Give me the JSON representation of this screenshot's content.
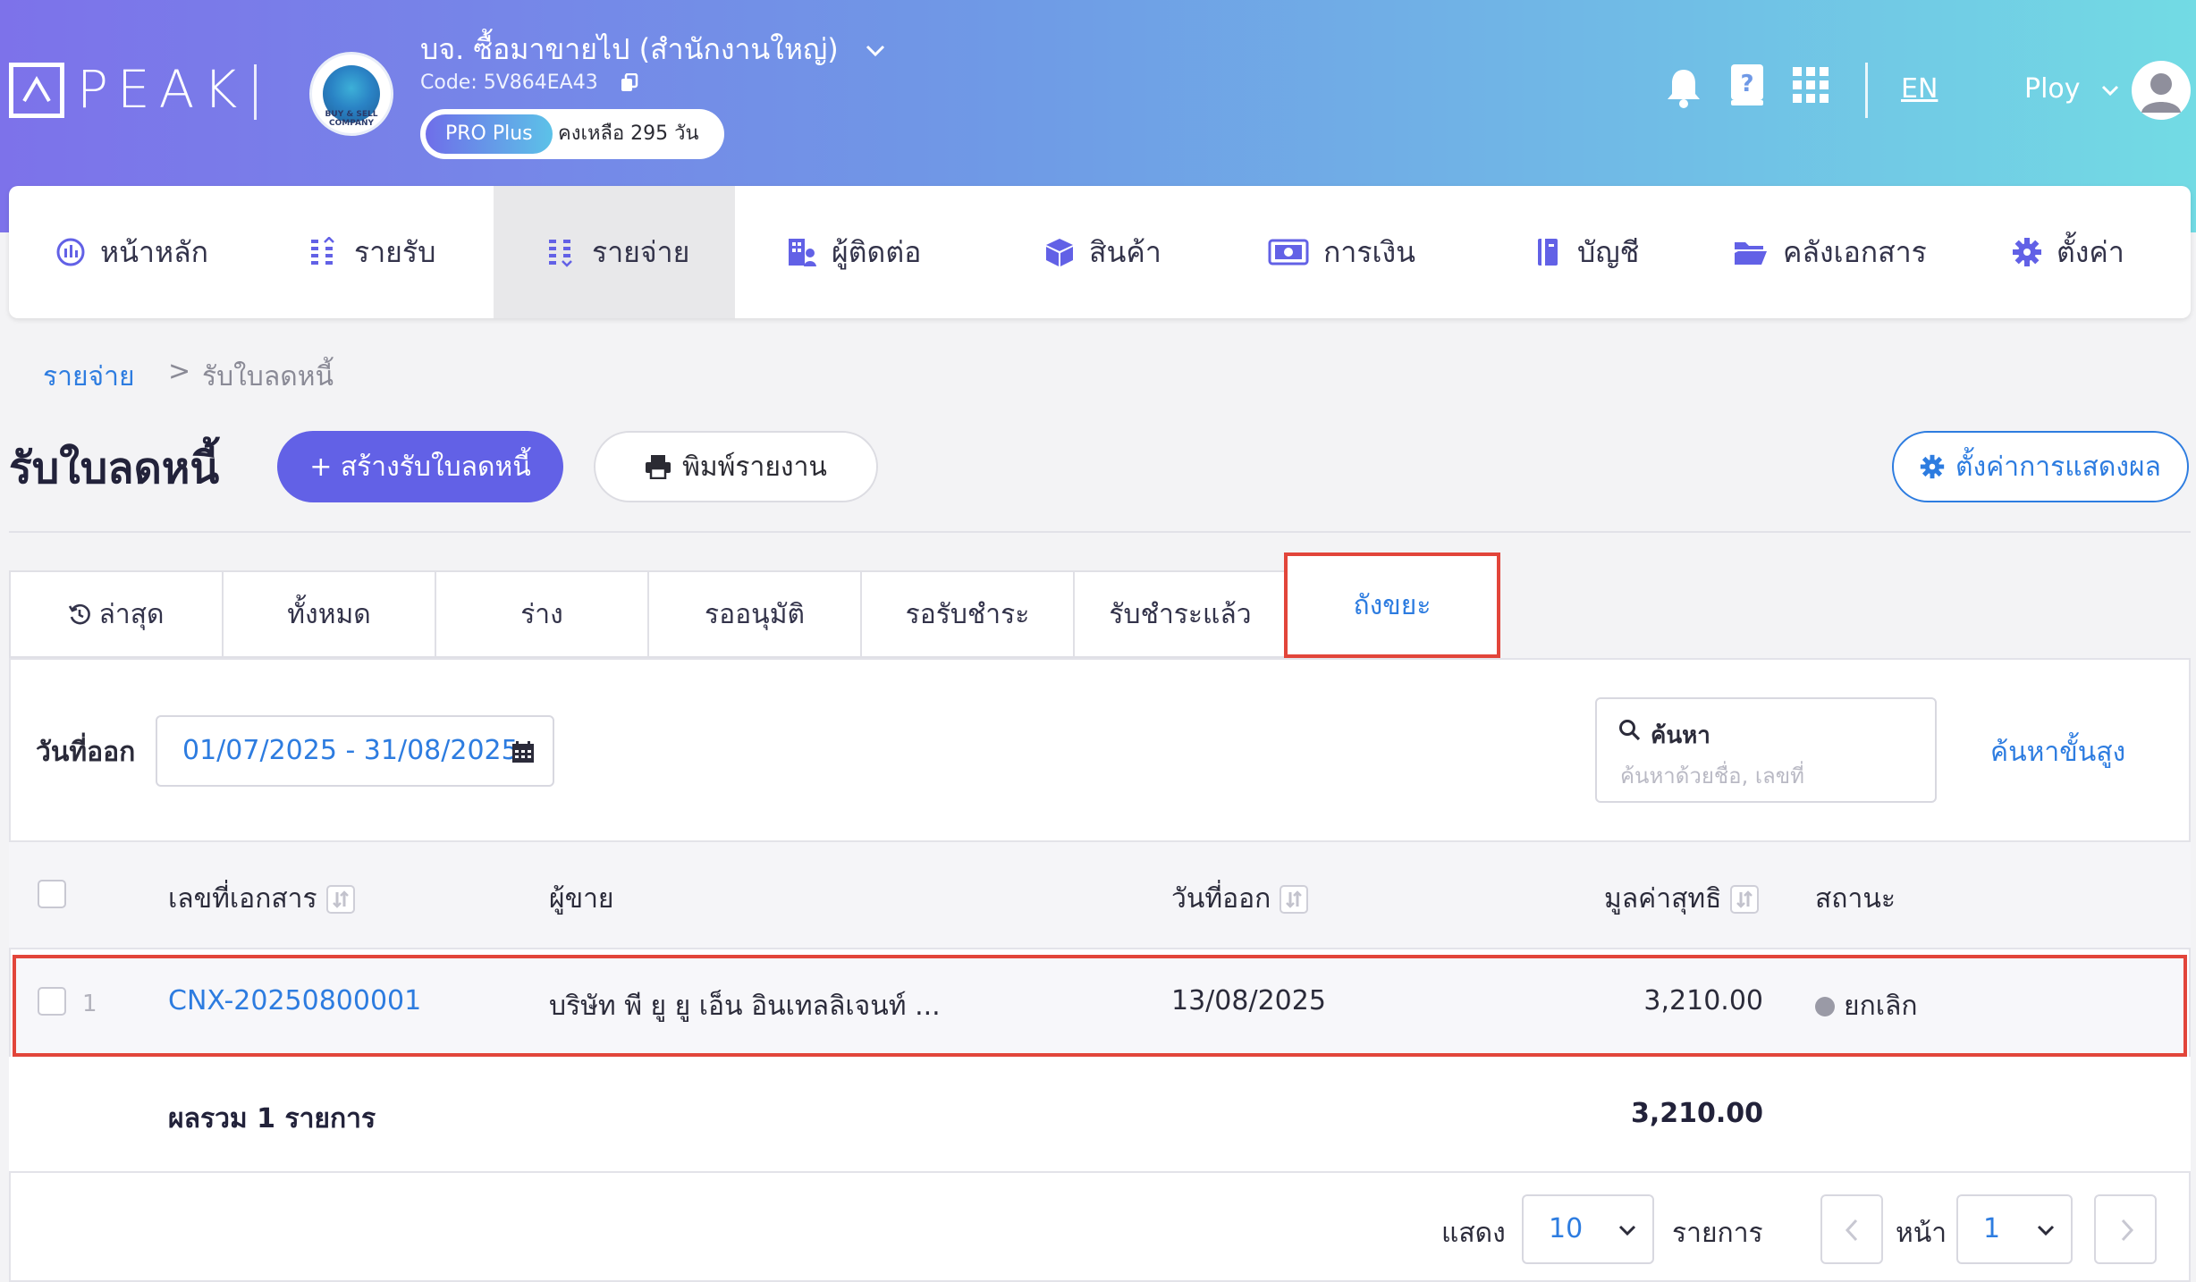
{
  "header": {
    "brand": "PEAK",
    "company_name": "บจ. ซื้อมาขายไป (สำนักงานใหญ่)",
    "company_code": "Code: 5V864EA43",
    "company_logo_text": "BUY & SELL COMPANY",
    "plan_badge": "PRO Plus",
    "plan_remaining": "คงเหลือ 295 วัน",
    "language": "EN",
    "user_name": "Ploy"
  },
  "nav": {
    "items": [
      {
        "label": "หน้าหลัก",
        "icon": "dashboard-icon"
      },
      {
        "label": "รายรับ",
        "icon": "income-icon"
      },
      {
        "label": "รายจ่าย",
        "icon": "expense-icon",
        "active": true
      },
      {
        "label": "ผู้ติดต่อ",
        "icon": "contacts-icon"
      },
      {
        "label": "สินค้า",
        "icon": "product-box-icon"
      },
      {
        "label": "การเงิน",
        "icon": "money-icon"
      },
      {
        "label": "บัญชี",
        "icon": "ledger-icon"
      },
      {
        "label": "คลังเอกสาร",
        "icon": "folder-icon"
      },
      {
        "label": "ตั้งค่า",
        "icon": "gear-icon"
      }
    ]
  },
  "breadcrumb": {
    "parent": "รายจ่าย",
    "separator": ">",
    "current": "รับใบลดหนี้"
  },
  "page": {
    "title": "รับใบลดหนี้",
    "create_button": "+ สร้างรับใบลดหนี้",
    "print_button": "พิมพ์รายงาน",
    "display_settings_button": "ตั้งค่าการแสดงผล"
  },
  "tabs": [
    {
      "label": "ล่าสุด"
    },
    {
      "label": "ทั้งหมด"
    },
    {
      "label": "ร่าง"
    },
    {
      "label": "รออนุมัติ"
    },
    {
      "label": "รอรับชำระ"
    },
    {
      "label": "รับชำระแล้ว"
    },
    {
      "label": "ถังขยะ",
      "active": true
    }
  ],
  "filters": {
    "date_label": "วันที่ออก",
    "date_range": "01/07/2025 - 31/08/2025",
    "search_label": "ค้นหา",
    "search_placeholder": "ค้นหาด้วยชื่อ, เลขที่",
    "advanced_search": "ค้นหาขั้นสูง"
  },
  "table": {
    "columns": [
      "เลขที่เอกสาร",
      "ผู้ขาย",
      "วันที่ออก",
      "มูลค่าสุทธิ",
      "สถานะ"
    ],
    "rows": [
      {
        "index": "1",
        "doc_no": "CNX-20250800001",
        "vendor": "บริษัท พี ยู ยู เอ็น อินเทลลิเจนท์ ...",
        "date": "13/08/2025",
        "amount": "3,210.00",
        "status": "ยกเลิก",
        "status_color": "#9a9aa6"
      }
    ],
    "summary_label": "ผลรวม 1 รายการ",
    "summary_amount": "3,210.00"
  },
  "pagination": {
    "show_label": "แสดง",
    "page_size": "10",
    "items_label": "รายการ",
    "page_label": "หน้า",
    "page_number": "1"
  },
  "colors": {
    "accent": "#6261e6",
    "link": "#2d7ce0",
    "highlight": "#e2453a"
  }
}
